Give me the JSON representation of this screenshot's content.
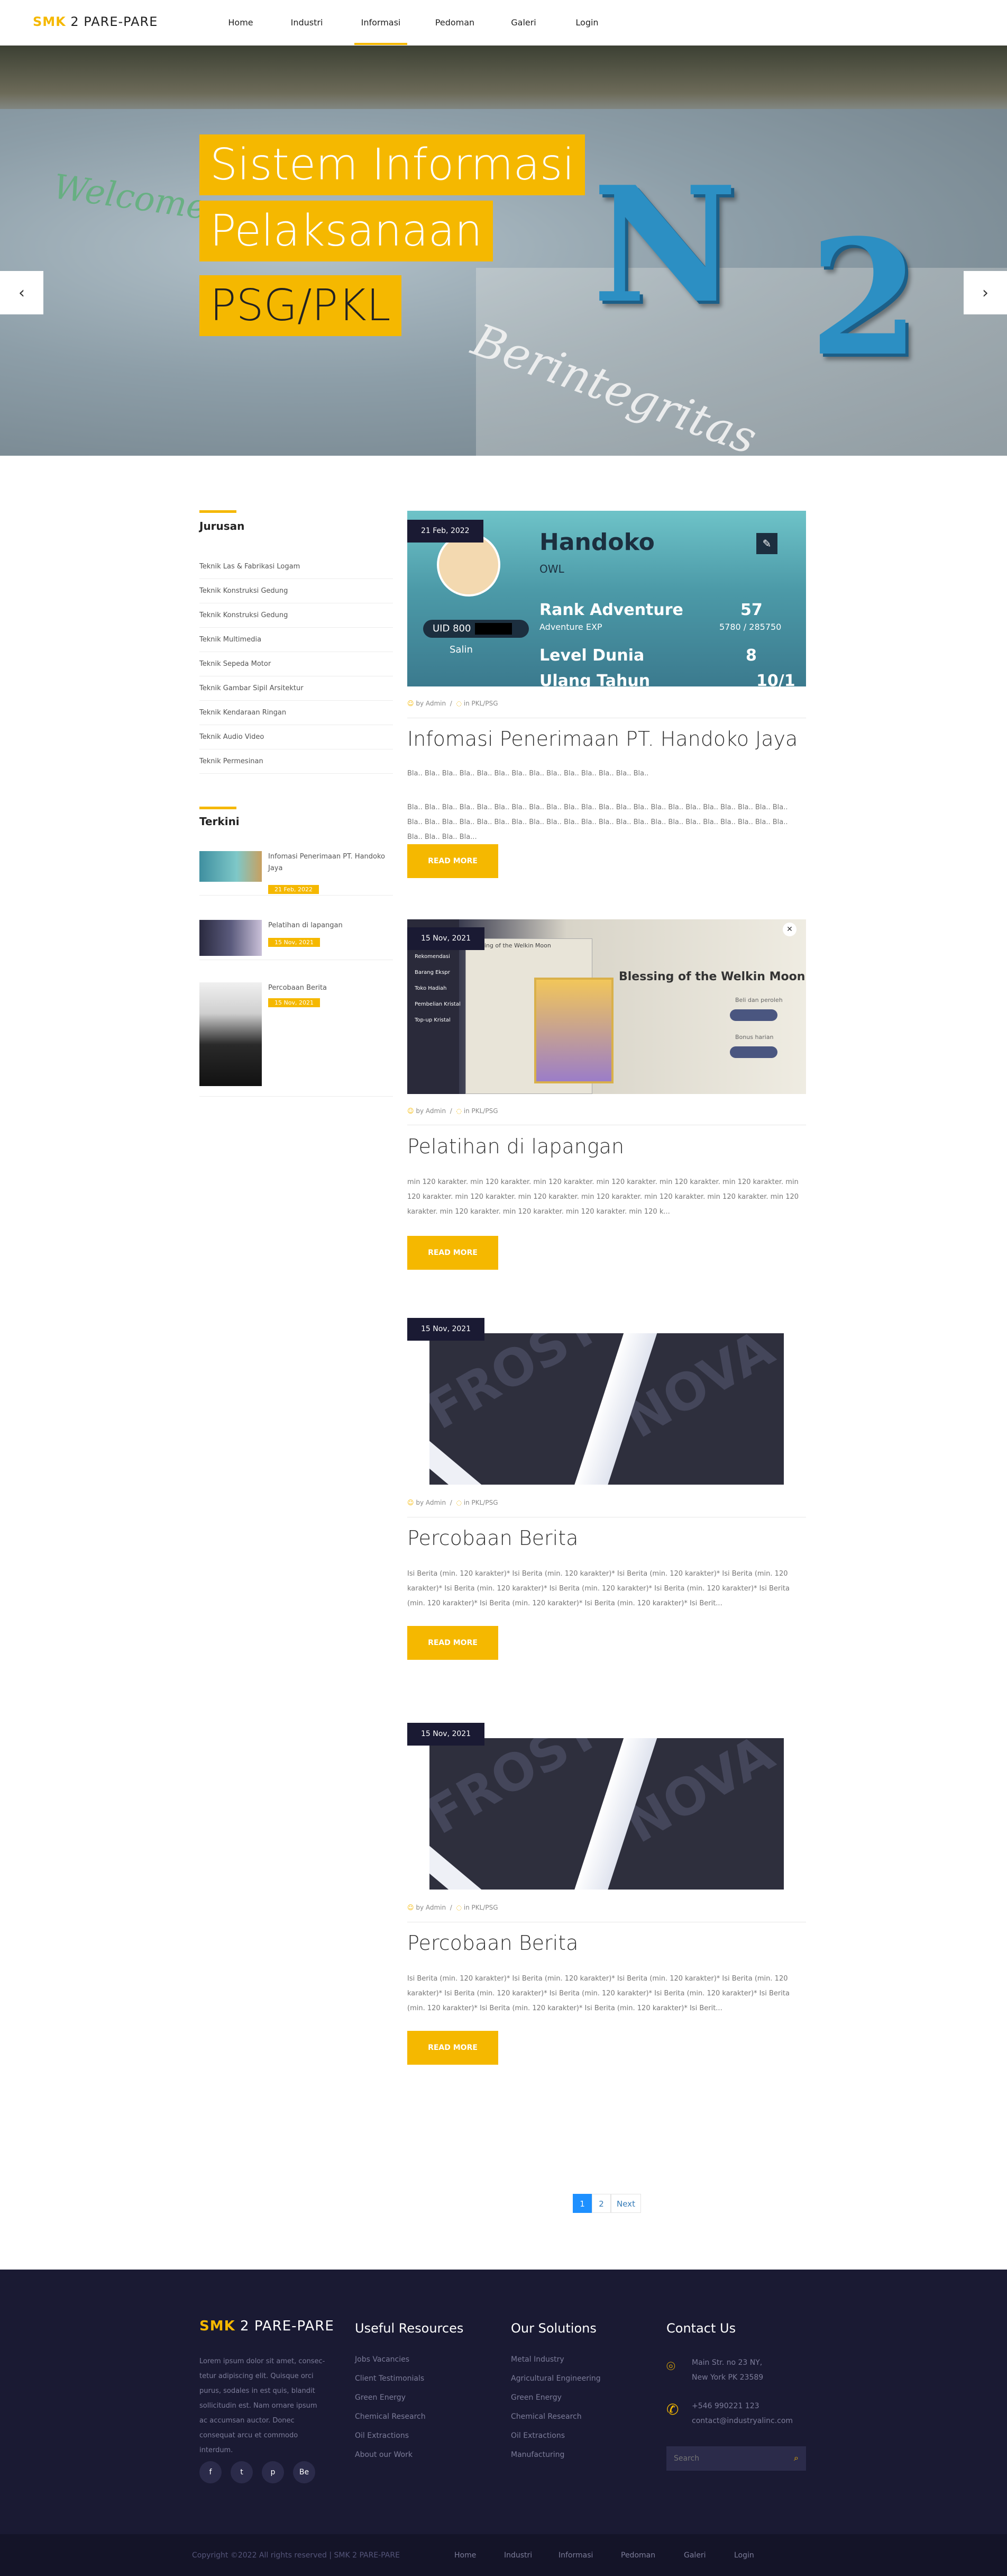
{
  "brand": {
    "smk": "SMK",
    "rest": "2 PARE-PARE"
  },
  "nav": {
    "items": [
      {
        "label": "Home"
      },
      {
        "label": "Industri"
      },
      {
        "label": "Informasi"
      },
      {
        "label": "Pedoman"
      },
      {
        "label": "Galeri"
      },
      {
        "label": "Login"
      }
    ],
    "active": "Informasi"
  },
  "hero": {
    "caption_lines": [
      "Sistem Informasi",
      "Pelaksanaan",
      "PSG/PKL"
    ],
    "prev_icon": "chevron-left-icon",
    "next_icon": "chevron-right-icon",
    "prev_glyph": "‹",
    "next_glyph": "›"
  },
  "sidebar": {
    "jurusan_title": "Jurusan",
    "jurusan": [
      "Teknik Las & Fabrikasi Logam",
      "Teknik Konstruksi Gedung",
      "Teknik Konstruksi Gedung",
      "Teknik Multimedia",
      "Teknik Sepeda Motor",
      "Teknik Gambar Sipil Arsitektur",
      "Teknik Kendaraan Ringan",
      "Teknik Audio Video",
      "Teknik Permesinan"
    ],
    "terkini_title": "Terkini",
    "recent": [
      {
        "title": "Infomasi Penerimaan PT. Handoko Jaya",
        "date": "21 Feb, 2022"
      },
      {
        "title": "Pelatihan di lapangan",
        "date": "15 Nov, 2021"
      },
      {
        "title": "Percobaan Berita",
        "date": "15 Nov, 2021"
      }
    ]
  },
  "posts": [
    {
      "date": "21 Feb, 2022",
      "author": "by Admin",
      "category": "in PKL/PSG",
      "title": "Infomasi Penerimaan PT. Handoko Jaya",
      "subtitle": "Bla.. Bla.. Bla.. Bla.. Bla.. Bla.. Bla.. Bla.. Bla.. Bla.. Bla.. Bla.. Bla.. Bla..",
      "excerpt": "Bla.. Bla.. Bla.. Bla.. Bla.. Bla.. Bla.. Bla.. Bla.. Bla.. Bla.. Bla.. Bla.. Bla.. Bla.. Bla.. Bla.. Bla.. Bla.. Bla.. Bla.. Bla.. Bla.. Bla.. Bla.. Bla.. Bla.. Bla.. Bla.. Bla.. Bla.. Bla.. Bla.. Bla.. Bla.. Bla.. Bla.. Bla.. Bla.. Bla.. Bla.. Bla.. Bla.. Bla.. Bla.. Bla.. Bla.. Bla...",
      "read_more": "READ MORE",
      "image": {
        "card_name": "Handoko",
        "sub": "OWL",
        "rank": "Rank Adventure",
        "rank_val": "57",
        "level": "Level Dunia",
        "level_val": "8",
        "uid": "UID 800",
        "exp": "Adventure EXP",
        "exp_val": "5780 / 285750",
        "ulang": "Ulang Tahun",
        "ulang_val": "10/1",
        "salin": "Salin"
      }
    },
    {
      "date": "15 Nov, 2021",
      "author": "by Admin",
      "category": "in PKL/PSG",
      "title": "Pelatihan di lapangan",
      "excerpt": "min 120 karakter. min 120 karakter. min 120 karakter. min 120 karakter. min 120 karakter. min 120 karakter. min 120 karakter. min 120 karakter. min 120 karakter. min 120 karakter. min 120 karakter. min 120 karakter. min 120 karakter. min 120 karakter. min 120 karakter. min 120 karakter. min 120 k...",
      "read_more": "READ MORE",
      "image": {
        "banner": "Blessing of the Welkin Moon",
        "side_title": "Blessing of the Welkin Moon",
        "menu": [
          "Rekomendasi",
          "Barang Ekspr",
          "Toko Hadiah",
          "Pembelian Kristal",
          "Top-up Kristal"
        ],
        "b1": "Beli dan peroleh",
        "b2": "Bonus harian"
      }
    },
    {
      "date": "15 Nov, 2021",
      "author": "by Admin",
      "category": "in PKL/PSG",
      "title": "Percobaan Berita",
      "excerpt": "Isi Berita (min. 120 karakter)* Isi Berita (min. 120 karakter)* Isi Berita (min. 120 karakter)* Isi Berita (min. 120 karakter)* Isi Berita (min. 120 karakter)* Isi Berita (min. 120 karakter)* Isi Berita (min. 120 karakter)* Isi Berita (min. 120 karakter)* Isi Berita (min. 120 karakter)* Isi Berita (min. 120 karakter)* Isi Berit...",
      "read_more": "READ MORE",
      "image": {
        "w1": "FROST",
        "w2": "NOVA"
      }
    },
    {
      "date": "15 Nov, 2021",
      "author": "by Admin",
      "category": "in PKL/PSG",
      "title": "Percobaan Berita",
      "excerpt": "Isi Berita (min. 120 karakter)* Isi Berita (min. 120 karakter)* Isi Berita (min. 120 karakter)* Isi Berita (min. 120 karakter)* Isi Berita (min. 120 karakter)* Isi Berita (min. 120 karakter)* Isi Berita (min. 120 karakter)* Isi Berita (min. 120 karakter)* Isi Berita (min. 120 karakter)* Isi Berita (min. 120 karakter)* Isi Berit...",
      "read_more": "READ MORE",
      "image": {
        "w1": "FROST",
        "w2": "NOVA"
      }
    }
  ],
  "pagination": {
    "pages": [
      "1",
      "2"
    ],
    "current": "1",
    "next": "Next"
  },
  "footer": {
    "brand_smk": "SMK",
    "brand_rest": "2 PARE-PARE",
    "about": "Lorem ipsum dolor sit amet, consec- tetur adipiscing elit. Quisque orci purus, sodales in est quis, blandit sollicitudin est. Nam ornare ipsum ac accumsan auctor. Donec consequat arcu et commodo interdum.",
    "social": [
      {
        "icon": "facebook-icon",
        "glyph": "f"
      },
      {
        "icon": "twitter-icon",
        "glyph": "t"
      },
      {
        "icon": "pinterest-icon",
        "glyph": "p"
      },
      {
        "icon": "behance-icon",
        "glyph": "Be"
      }
    ],
    "useful_title": "Useful Resources",
    "useful": [
      "Jobs Vacancies",
      "Client Testimonials",
      "Green Energy",
      "Chemical Research",
      "Oil Extractions",
      "About our Work"
    ],
    "solutions_title": "Our Solutions",
    "solutions": [
      "Metal Industry",
      "Agricultural Engineering",
      "Green Energy",
      "Chemical Research",
      "Oil Extractions",
      "Manufacturing"
    ],
    "contact_title": "Contact Us",
    "address": [
      "Main Str. no 23 NY,",
      "New York PK 23589"
    ],
    "phone": [
      "+546 990221 123",
      "contact@industryalinc.com"
    ],
    "search_placeholder": "Search",
    "copyright": "Copyright ©2022 All rights reserved | SMK 2 PARE-PARE",
    "bottom_nav": [
      "Home",
      "Industri",
      "Informasi",
      "Pedoman",
      "Galeri",
      "Login"
    ]
  },
  "colors": {
    "accent": "#f5b800",
    "footer": "#1a1a33",
    "badge": "#1a1a33"
  }
}
